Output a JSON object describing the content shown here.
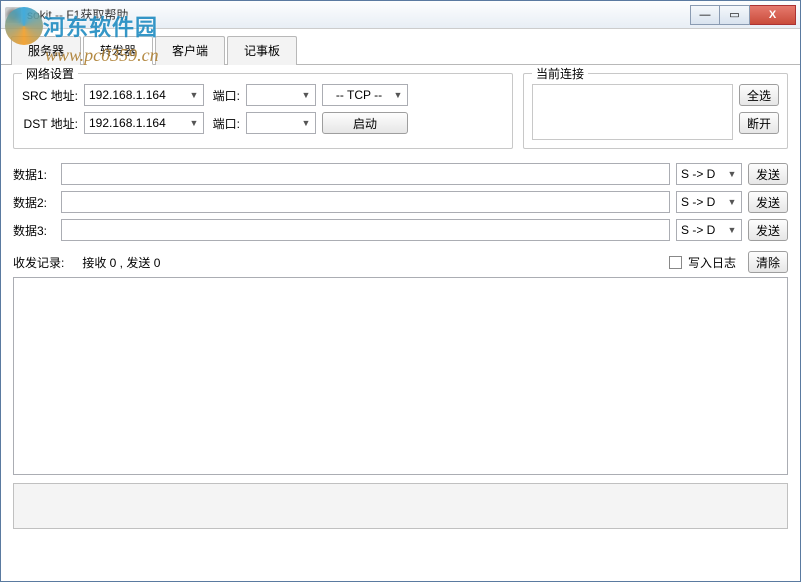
{
  "window": {
    "title": "sokit -- F1获取帮助",
    "min": "—",
    "max": "▭",
    "close": "X"
  },
  "watermark": {
    "name": "河东软件园",
    "url": "www.pc0359.cn"
  },
  "tabs": {
    "items": [
      {
        "label": "服务器"
      },
      {
        "label": "转发器"
      },
      {
        "label": "客户端"
      },
      {
        "label": "记事板"
      }
    ]
  },
  "netset": {
    "legend": "网络设置",
    "src_label": "SRC 地址:",
    "dst_label": "DST 地址:",
    "port_label": "端口:",
    "src_addr": "192.168.1.164",
    "dst_addr": "192.168.1.164",
    "src_port": "",
    "dst_port": "",
    "proto": "-- TCP --",
    "start": "启动"
  },
  "conn": {
    "legend": "当前连接",
    "select_all": "全选",
    "disconnect": "断开"
  },
  "data": {
    "rows": [
      {
        "label": "数据1:",
        "value": "",
        "dir": "S -> D",
        "send": "发送"
      },
      {
        "label": "数据2:",
        "value": "",
        "dir": "S -> D",
        "send": "发送"
      },
      {
        "label": "数据3:",
        "value": "",
        "dir": "S -> D",
        "send": "发送"
      }
    ]
  },
  "log": {
    "header_label": "收发记录:",
    "stats": "接收 0 , 发送 0",
    "write_log": "写入日志",
    "clear": "清除"
  }
}
